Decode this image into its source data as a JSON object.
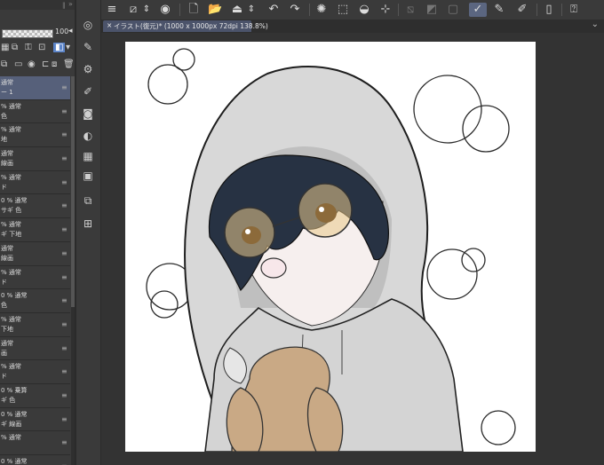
{
  "layer_panel": {
    "opacity_value": "100",
    "layers": [
      {
        "line1": "通常",
        "line2": "ー 1",
        "selected": true
      },
      {
        "line1": "% 通常",
        "line2": "色"
      },
      {
        "line1": "% 通常",
        "line2": "地"
      },
      {
        "line1": "通常",
        "line2": "線画"
      },
      {
        "line1": "% 通常",
        "line2": "ド"
      },
      {
        "line1": "0 % 通常",
        "line2": "サギ 色"
      },
      {
        "line1": "% 通常",
        "line2": "ギ 下地"
      },
      {
        "line1": "通常",
        "line2": "線画"
      },
      {
        "line1": "% 通常",
        "line2": "ド"
      },
      {
        "line1": "0 % 通常",
        "line2": "色"
      },
      {
        "line1": "% 通常",
        "line2": "下地"
      },
      {
        "line1": "通常",
        "line2": "画"
      },
      {
        "line1": "% 通常",
        "line2": "ド"
      },
      {
        "line1": "0 % 乗算",
        "line2": "ギ 色"
      },
      {
        "line1": "0 % 通常",
        "line2": "ギ 線画"
      },
      {
        "line1": "% 通常",
        "line2": ""
      },
      {
        "line1": "0 % 通常",
        "line2": ""
      }
    ]
  },
  "tab": {
    "close_glyph": "×",
    "title": "イラスト(復元)* (1000 x 1000px 72dpi 138.8%)"
  },
  "icons": {
    "menu": "≡",
    "tab_menu": "⌄"
  }
}
